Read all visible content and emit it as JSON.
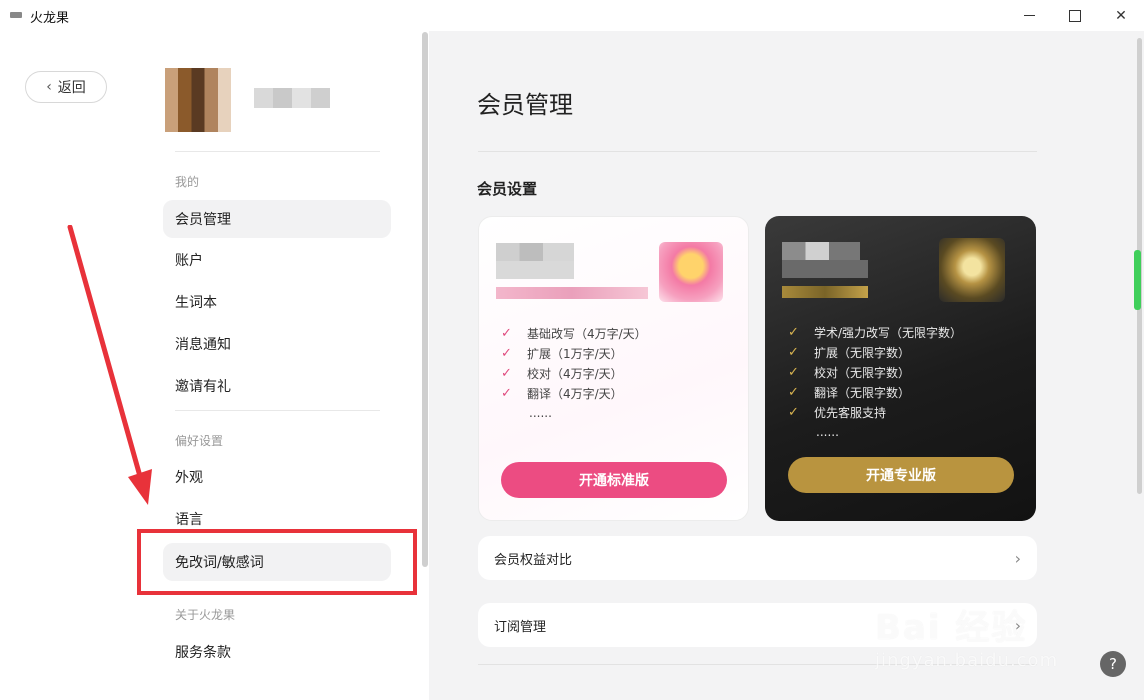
{
  "window": {
    "title": "火龙果"
  },
  "nav": {
    "back_label": "返回",
    "section_mine": "我的",
    "items_mine": [
      "会员管理",
      "账户",
      "生词本",
      "消息通知",
      "邀请有礼"
    ],
    "section_prefs": "偏好设置",
    "items_prefs": [
      "外观",
      "语言",
      "免改词/敏感词"
    ],
    "section_about": "关于火龙果",
    "items_about": [
      "服务条款"
    ]
  },
  "main": {
    "page_title": "会员管理",
    "section_title": "会员设置",
    "standard": {
      "features": [
        "基础改写（4万字/天）",
        "扩展（1万字/天）",
        "校对（4万字/天）",
        "翻译（4万字/天）"
      ],
      "ellipsis": "......",
      "cta": "开通标准版"
    },
    "pro": {
      "features": [
        "学术/强力改写（无限字数）",
        "扩展（无限字数）",
        "校对（无限字数）",
        "翻译（无限字数）",
        "优先客服支持"
      ],
      "ellipsis": "......",
      "cta": "开通专业版"
    },
    "rows": {
      "compare": "会员权益对比",
      "subscription": "订阅管理"
    }
  },
  "watermark": {
    "line1": "Bai 经验",
    "line2": "jingyan.baidu.com"
  },
  "help": {
    "label": "?"
  },
  "colors": {
    "accent_pink": "#ec4c82",
    "accent_gold": "#b9943f",
    "annotation_red": "#e8323a"
  }
}
